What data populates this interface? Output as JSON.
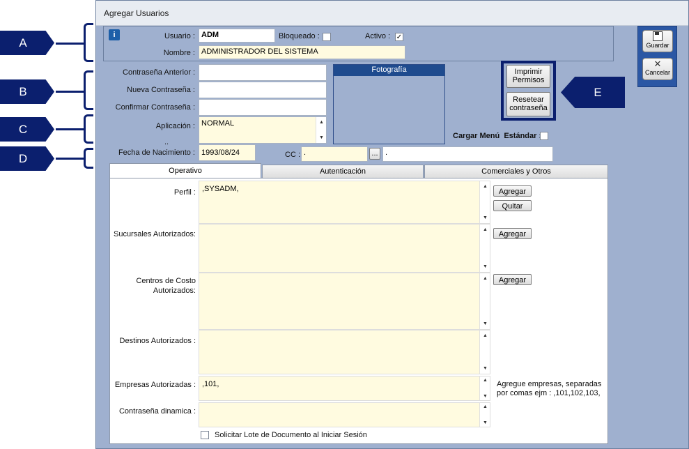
{
  "window": {
    "title": "Agregar Usuarios"
  },
  "header": {
    "usuario_label": "Usuario :",
    "usuario_value": "ADM",
    "bloqueado_label": "Bloqueado :",
    "activo_label": "Activo :",
    "activo_check": "✓",
    "nombre_label": "Nombre :",
    "nombre_value": "ADMINISTRADOR DEL SISTEMA"
  },
  "password": {
    "anterior_label": "Contraseña Anterior :",
    "nueva_label": "Nueva Contraseña :",
    "confirmar_label": "Confirmar Contraseña :"
  },
  "aplicacion": {
    "label": "Aplicación :",
    "value": "NORMAL",
    "dots": ".."
  },
  "fecha": {
    "label": "Fecha de Nacimiento :",
    "value": "1993/08/24"
  },
  "cc": {
    "label": "CC :",
    "value": ".",
    "browse": "...",
    "desc": "."
  },
  "foto": {
    "title": "Fotografía"
  },
  "actions": {
    "imprimir": "Imprimir Permisos",
    "resetear": "Resetear contraseña",
    "cargar_menu_label": "Cargar Menú  Estándar :"
  },
  "toolbar": {
    "guardar": "Guardar",
    "cancelar": "Cancelar"
  },
  "tabs": [
    "Operativo",
    "Autenticación",
    "Comerciales y Otros"
  ],
  "fields": {
    "perfil_label": "Perfil :",
    "perfil_value": ",SYSADM,",
    "agregar": "Agregar",
    "quitar": "Quitar",
    "sucursales_label": "Sucursales Autorizados:",
    "centros_label_1": "Centros de Costo",
    "centros_label_2": "Autorizados:",
    "destinos_label": "Destinos Autorizados :",
    "empresas_label": "Empresas Autorizadas :",
    "empresas_value": ",101,",
    "empresas_hint_1": "Agregue empresas, separadas",
    "empresas_hint_2": "por comas ejm : ,101,102,103,",
    "dinamica_label": "Contraseña dinamica :",
    "solicitar_label": "Solicitar Lote de Documento al Iniciar Sesión"
  },
  "markers": {
    "a": "A",
    "b": "B",
    "c": "C",
    "d": "D",
    "e": "E"
  },
  "colors": {
    "marker": "#0b1f6e",
    "form_bg": "#9fb0cf",
    "field_yellow": "#fffbe0"
  },
  "icons": {
    "info": "info-icon",
    "save": "floppy-disk-icon",
    "cancel": "cancel-x-icon"
  }
}
